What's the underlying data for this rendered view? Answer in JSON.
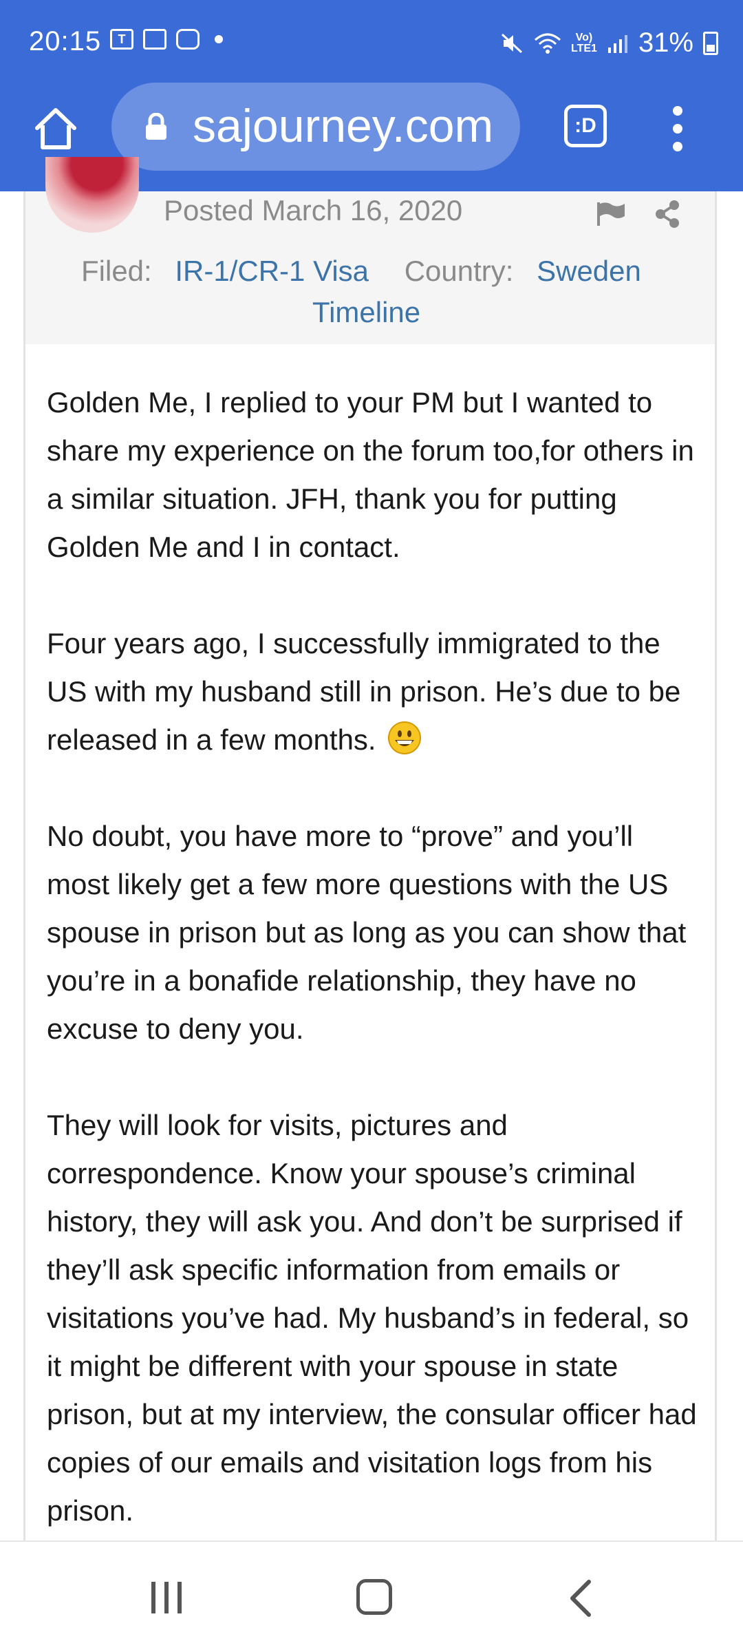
{
  "status_bar": {
    "time": "20:15",
    "notif_t": "T",
    "volte_top": "Vo)",
    "volte_bottom": "LTE1",
    "battery": "31%"
  },
  "browser": {
    "url": "sajourney.com",
    "tab_label": ":D"
  },
  "post": {
    "posted_label": "Posted",
    "posted_date": "March 16, 2020",
    "filed_label": "Filed:",
    "filed_value": "IR-1/CR-1 Visa",
    "country_label": "Country:",
    "country_value": "Sweden",
    "timeline_link": "Timeline",
    "paragraphs": [
      "Golden Me, I replied to your PM but I wanted to share my experience on the forum too,for others in a similar situation. JFH, thank you for putting Golden Me and I in contact.",
      "Four years ago, I successfully immigrated to the US with my husband still in prison. He’s due to be released in a few months.",
      "No doubt, you have more to “prove” and you’ll most likely get a few more questions with the US spouse in prison but as long as you can show that you’re in a bonafide relationship, they have no excuse to deny you.",
      "They will look for visits, pictures and correspondence. Know your spouse’s criminal history, they will ask you. And don’t be surprised if they’ll ask specific information from emails or visitations you’ve had. My husband’s in federal, so it might be different with your spouse in state prison, but at my interview, the consular officer had copies of our emails and visitation logs from his prison."
    ]
  },
  "colors": {
    "chrome_blue": "#3b6bd6",
    "url_pill": "#6c91e3",
    "link_blue": "#3c73a8",
    "meta_gray": "#8a8a8a"
  },
  "icons": {
    "home": "home-icon",
    "lock": "lock-icon",
    "menu": "more-vert-icon",
    "flag": "flag-icon",
    "share": "share-icon",
    "emoji": "grinning-face-emoji"
  }
}
